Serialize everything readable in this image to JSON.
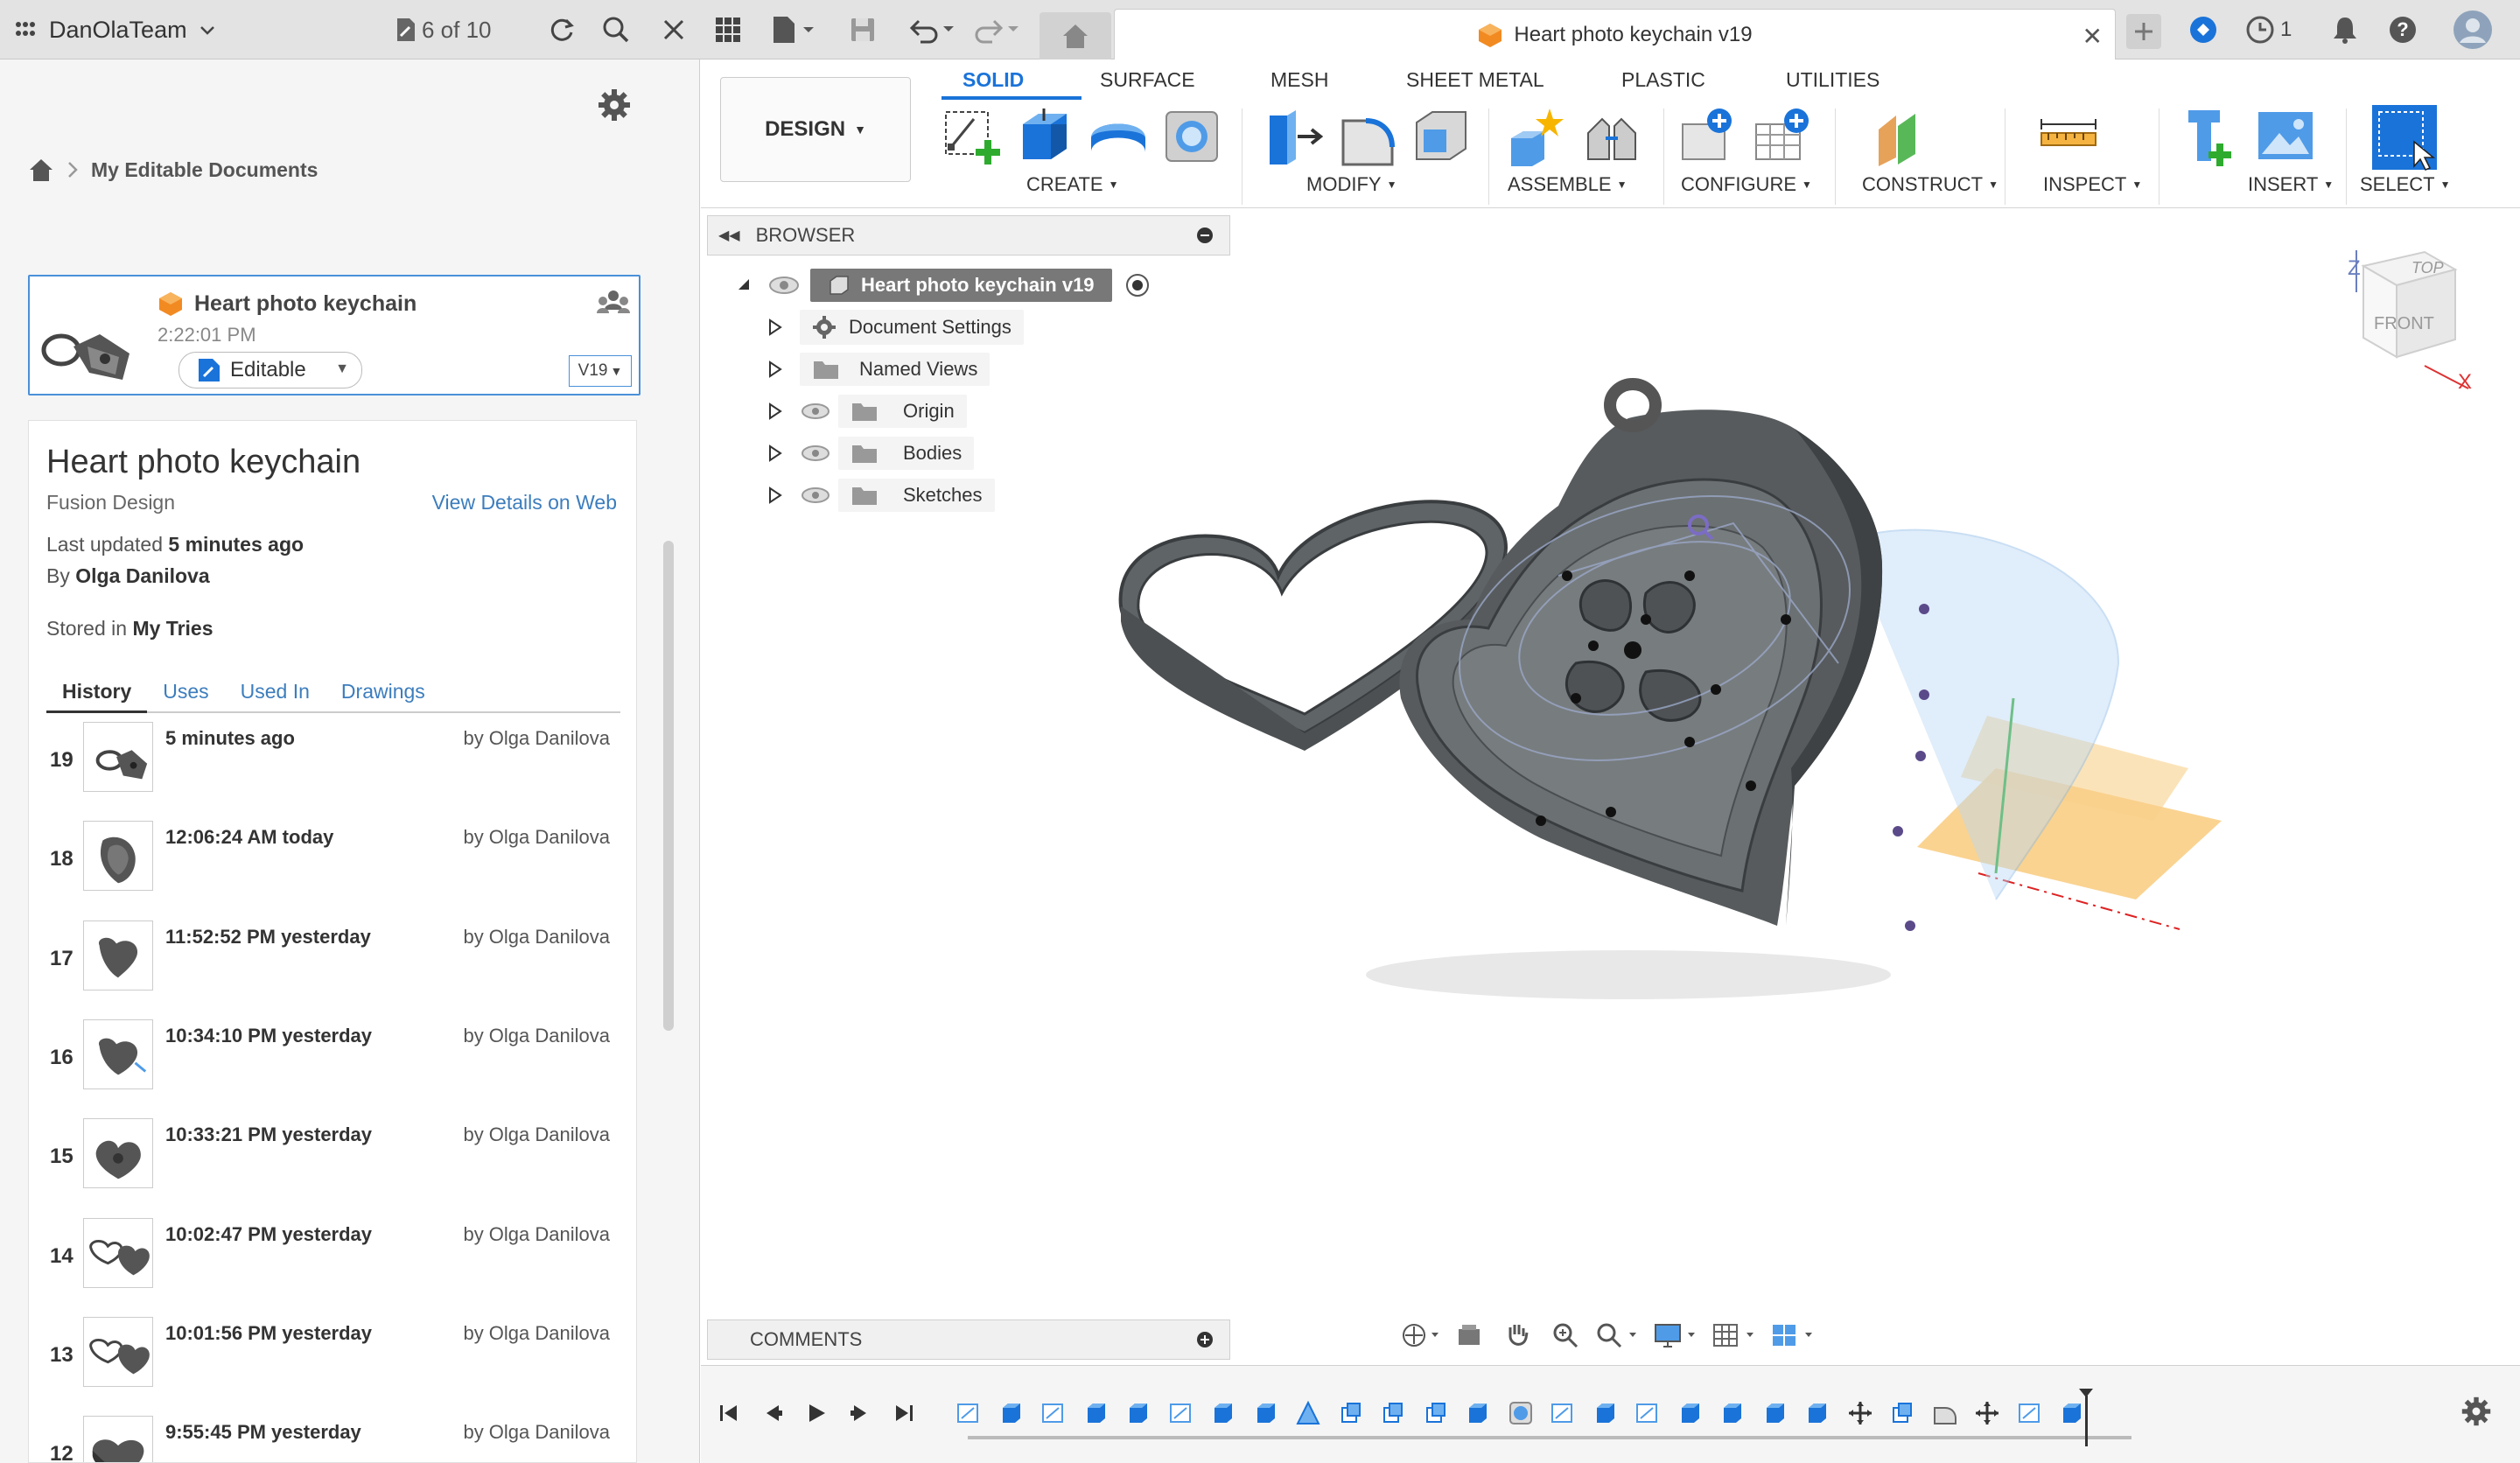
{
  "topbar": {
    "team_name": "DanOlaTeam",
    "doc_counter": "6 of 10",
    "doc_tab_title": "Heart photo keychain v19",
    "jobs_count": "1"
  },
  "left_panel": {
    "breadcrumb": "My Editable Documents",
    "card": {
      "title": "Heart photo keychain",
      "time": "2:22:01 PM",
      "status": "Editable",
      "version": "V19"
    },
    "details": {
      "title": "Heart photo keychain",
      "type": "Fusion Design",
      "view_link": "View Details on Web",
      "updated_label": "Last updated",
      "updated_value": "5 minutes ago",
      "by_label": "By",
      "by_value": "Olga Danilova",
      "stored_label": "Stored in",
      "stored_value": "My Tries"
    },
    "tabs": [
      "History",
      "Uses",
      "Used In",
      "Drawings"
    ],
    "history": [
      {
        "num": "19",
        "time": "5 minutes ago",
        "by": "by Olga Danilova"
      },
      {
        "num": "18",
        "time": "12:06:24 AM today",
        "by": "by Olga Danilova"
      },
      {
        "num": "17",
        "time": "11:52:52 PM yesterday",
        "by": "by Olga Danilova"
      },
      {
        "num": "16",
        "time": "10:34:10 PM yesterday",
        "by": "by Olga Danilova"
      },
      {
        "num": "15",
        "time": "10:33:21 PM yesterday",
        "by": "by Olga Danilova"
      },
      {
        "num": "14",
        "time": "10:02:47 PM yesterday",
        "by": "by Olga Danilova"
      },
      {
        "num": "13",
        "time": "10:01:56 PM yesterday",
        "by": "by Olga Danilova"
      },
      {
        "num": "12",
        "time": "9:55:45 PM yesterday",
        "by": "by Olga Danilova"
      }
    ]
  },
  "toolbar": {
    "workspace": "DESIGN",
    "tabs": [
      "SOLID",
      "SURFACE",
      "MESH",
      "SHEET METAL",
      "PLASTIC",
      "UTILITIES"
    ],
    "groups": [
      "CREATE",
      "MODIFY",
      "ASSEMBLE",
      "CONFIGURE",
      "CONSTRUCT",
      "INSPECT",
      "INSERT",
      "SELECT"
    ]
  },
  "browser": {
    "header": "BROWSER",
    "root": "Heart photo keychain v19",
    "items": [
      "Document Settings",
      "Named Views",
      "Origin",
      "Bodies",
      "Sketches"
    ]
  },
  "viewcube": {
    "top": "TOP",
    "front": "FRONT",
    "z": "Z",
    "x": "X"
  },
  "comments": {
    "label": "COMMENTS"
  },
  "colors": {
    "accent": "#1a73d9",
    "link": "#3c7dbd",
    "model_body": "#6b6e70",
    "plane": "#f5c26b"
  }
}
